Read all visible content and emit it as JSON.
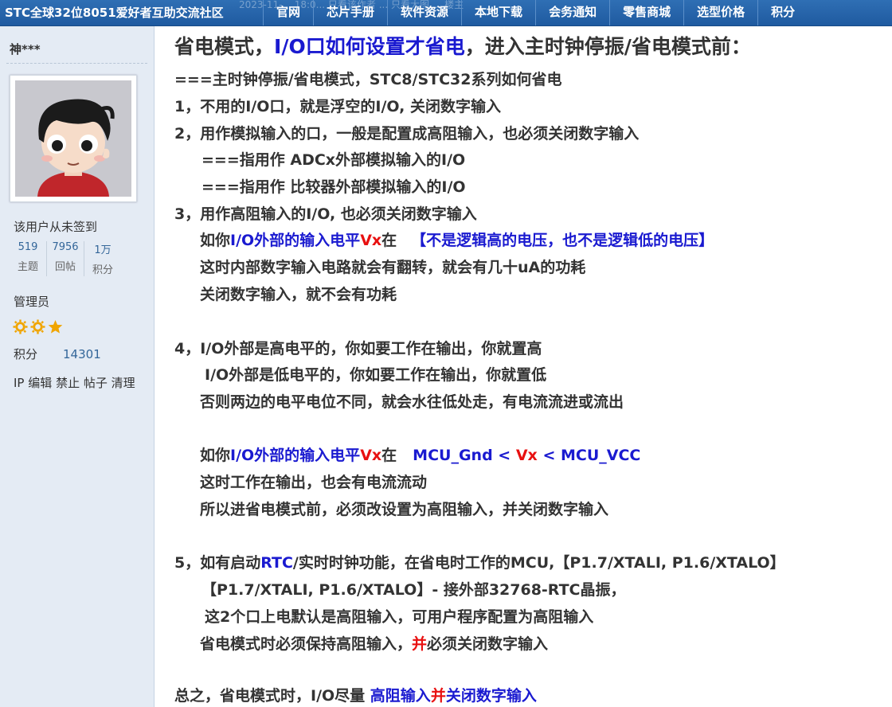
{
  "header": {
    "site_title": "STC全球32位8051爱好者互助交流社区",
    "faint_text": "2023-11-... 18:0... 只看该作者 ... 只看大图 ... 楼主",
    "nav": [
      "官网",
      "芯片手册",
      "软件资源",
      "本地下载",
      "会务通知",
      "零售商城",
      "选型价格",
      "积分"
    ]
  },
  "sidebar": {
    "username": "神***",
    "sign_status": "该用户从未签到",
    "stats": [
      {
        "value": "519",
        "label": "主题"
      },
      {
        "value": "7956",
        "label": "回帖"
      },
      {
        "value": "1万",
        "label": "积分"
      }
    ],
    "role": "管理员",
    "stars": [
      "sun-icon",
      "sun-icon",
      "star-icon"
    ],
    "points_label": "积分",
    "points_value": "14301",
    "admin_links": [
      "IP",
      "编辑",
      "禁止",
      "帖子",
      "清理"
    ]
  },
  "post": {
    "headline": {
      "a": "省电模式，",
      "b": "I/O口如何设置才省电",
      "c": "，进入主时钟停振/省电模式前："
    },
    "l1": "===主时钟停振/省电模式，STC8/STC32系列如何省电",
    "l2": "1，不用的I/O口，就是浮空的I/O, 关闭数字输入",
    "l3": "2，用作模拟输入的口，一般是配置成高阻输入，也必须关闭数字输入",
    "l4": "===指用作 ADCx外部模拟输入的I/O",
    "l5": "===指用作 比较器外部模拟输入的I/O",
    "l6": "3，用作高阻输入的I/O, 也必须关闭数字输入",
    "l7": {
      "a": "如你",
      "b": "I/O外部的输入电平",
      "c": "Vx",
      "d": "在",
      "e": "【不是逻辑高的电压，也不是逻辑低的电压】"
    },
    "l8": "这时内部数字输入电路就会有翻转，就会有几十uA的功耗",
    "l9": "关闭数字输入，就不会有功耗",
    "l10": "4，I/O外部是高电平的，你如要工作在输出，你就置高",
    "l11": "I/O外部是低电平的，你如要工作在输出，你就置低",
    "l12": "否则两边的电平电位不同，就会水往低处走，有电流流进或流出",
    "l13": {
      "a": "如你",
      "b": "I/O外部的输入电平",
      "c": "Vx",
      "d": "在",
      "e": "MCU_Gnd <",
      "f": "Vx",
      "g": "< MCU_VCC"
    },
    "l14": "这时工作在输出，也会有电流流动",
    "l15": "所以进省电模式前，必须改设置为高阻输入，并关闭数字输入",
    "l16": {
      "a": "5，如有启动",
      "b": "RTC",
      "c": "/实时时钟功能，在省电时工作的MCU,【P1.7/XTALI, P1.6/XTALO】"
    },
    "l17": "【P1.7/XTALI, P1.6/XTALO】- 接外部32768-RTC晶振，",
    "l18": "这2个口上电默认是高阻输入，可用户程序配置为高阻输入",
    "l19": {
      "a": "省电模式时必须保持高阻输入，",
      "b": "并",
      "c": "必须关闭数字输入"
    },
    "l20": {
      "a": "总之，省电模式时，I/O尽量",
      "b": "高阻输入",
      "c": "并",
      "d": "关闭数字输入"
    }
  },
  "colors": {
    "nav_bg": "#2a66ab",
    "sidebar_bg": "#e4ebf4",
    "blue_text": "#1a1ad0",
    "red_text": "#e81010",
    "stat_blue": "#336699"
  }
}
